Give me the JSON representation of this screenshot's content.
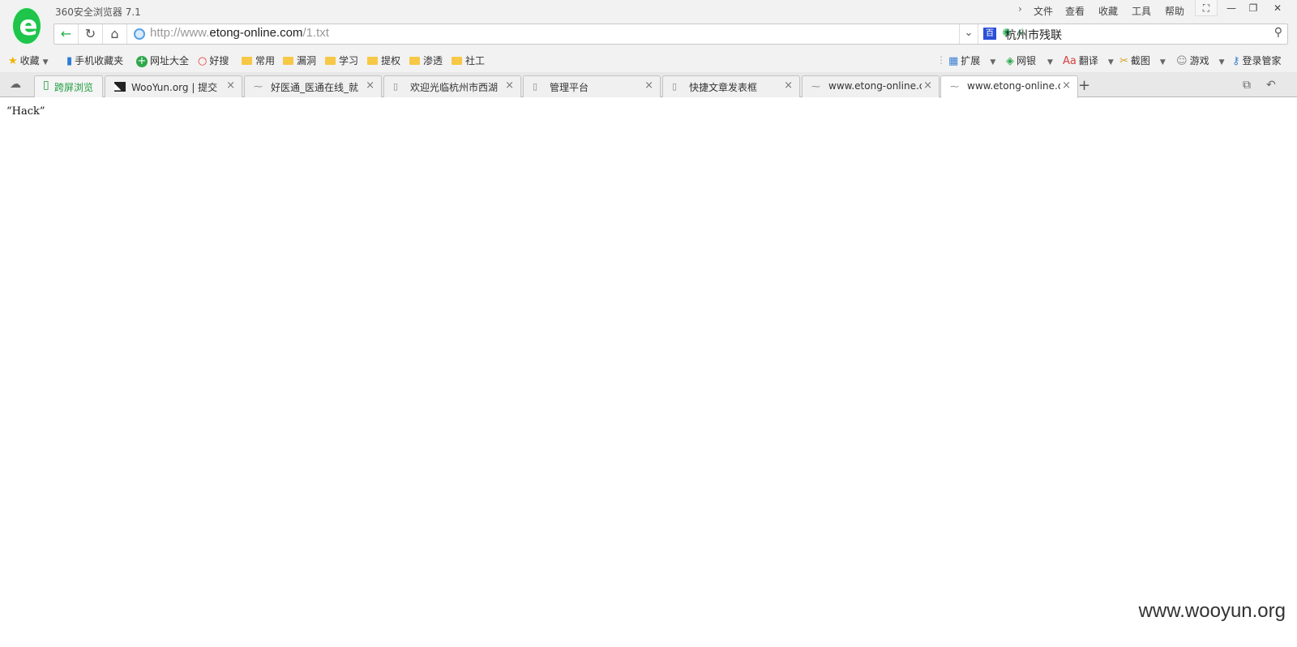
{
  "app": {
    "title": "360安全浏览器 7.1",
    "logo_letter": "e"
  },
  "menu": {
    "chevron": "›",
    "items": [
      "文件",
      "查看",
      "收藏",
      "工具",
      "帮助"
    ]
  },
  "window_controls": {
    "skin": "⛶",
    "minimize": "—",
    "maximize": "❐",
    "close": "✕"
  },
  "nav": {
    "back": "←",
    "refresh": "↻",
    "home": "⌂",
    "url_prefix": "http://www.",
    "url_host": "etong-online.com",
    "url_path": "/1.txt",
    "speed_icon": "✺",
    "lightning_icon": "⚡",
    "dropdown": "⌄",
    "search_engine_icon": "百",
    "search_value": "杭州市残联",
    "search_button": "⚲"
  },
  "bookmarks": {
    "items": [
      {
        "label": "收藏",
        "icon": "star-icon"
      },
      {
        "label": "手机收藏夹",
        "icon": "phone-icon"
      },
      {
        "label": "网址大全",
        "icon": "plus-icon"
      },
      {
        "label": "好搜",
        "icon": "ring-icon"
      },
      {
        "label": "常用",
        "icon": "folder-icon"
      },
      {
        "label": "漏洞",
        "icon": "folder-icon"
      },
      {
        "label": "学习",
        "icon": "folder-icon"
      },
      {
        "label": "提权",
        "icon": "folder-icon"
      },
      {
        "label": "渗透",
        "icon": "folder-icon"
      },
      {
        "label": "社工",
        "icon": "folder-icon"
      }
    ],
    "right": [
      {
        "label": "扩展",
        "icon": "grid-icon"
      },
      {
        "label": "网银",
        "icon": "shield-icon"
      },
      {
        "label": "翻译",
        "icon": "translate-icon"
      },
      {
        "label": "截图",
        "icon": "scissors-icon"
      },
      {
        "label": "游戏",
        "icon": "gamepad-icon"
      },
      {
        "label": "登录管家",
        "icon": "key-icon"
      }
    ]
  },
  "tabs": [
    {
      "label": "跨屏浏览",
      "type": "cross"
    },
    {
      "label": "WooYun.org | 提交",
      "close": "×"
    },
    {
      "label": "好医通_医通在线_就",
      "close": "×"
    },
    {
      "label": "欢迎光临杭州市西湖",
      "close": "×"
    },
    {
      "label": "管理平台",
      "close": "×"
    },
    {
      "label": "快捷文章发表框",
      "close": "×"
    },
    {
      "label": "www.etong-online.c",
      "close": "×"
    },
    {
      "label": "www.etong-online.c",
      "close": "×",
      "active": true
    }
  ],
  "tab_controls": {
    "new_tab": "+",
    "restore": "⧉",
    "undo": "↶",
    "cloud": "☁"
  },
  "page": {
    "text": "“Hack”"
  },
  "watermark": "www.wooyun.org"
}
